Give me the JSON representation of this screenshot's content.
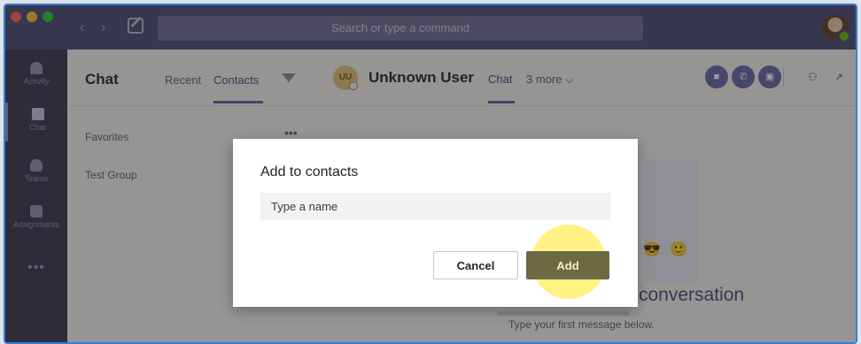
{
  "titlebar": {
    "search_placeholder": "Search or type a command"
  },
  "rail": {
    "items": [
      {
        "label": "Activity",
        "icon": "bell-icon"
      },
      {
        "label": "Chat",
        "icon": "chat-icon"
      },
      {
        "label": "Teams",
        "icon": "teams-icon"
      },
      {
        "label": "Assignments",
        "icon": "assignments-icon"
      }
    ],
    "more": "•••"
  },
  "list": {
    "title": "Chat",
    "tabs": [
      "Recent",
      "Contacts"
    ],
    "rows": [
      "Favorites",
      "Test Group"
    ],
    "more": "•••"
  },
  "chat_header": {
    "avatar_initials": "UU",
    "user_name": "Unknown User",
    "tab_chat": "Chat",
    "tab_more": "3 more ⌵"
  },
  "chat_body": {
    "conversation_title": "conversation",
    "conversation_sub": "Type your first message below."
  },
  "dialog": {
    "title": "Add to contacts",
    "input_placeholder": "Type a name",
    "cancel_label": "Cancel",
    "add_label": "Add"
  },
  "colors": {
    "brand": "#6264a7",
    "titlebar": "#464775",
    "rail": "#33344a",
    "highlight": "#ffee5a"
  }
}
